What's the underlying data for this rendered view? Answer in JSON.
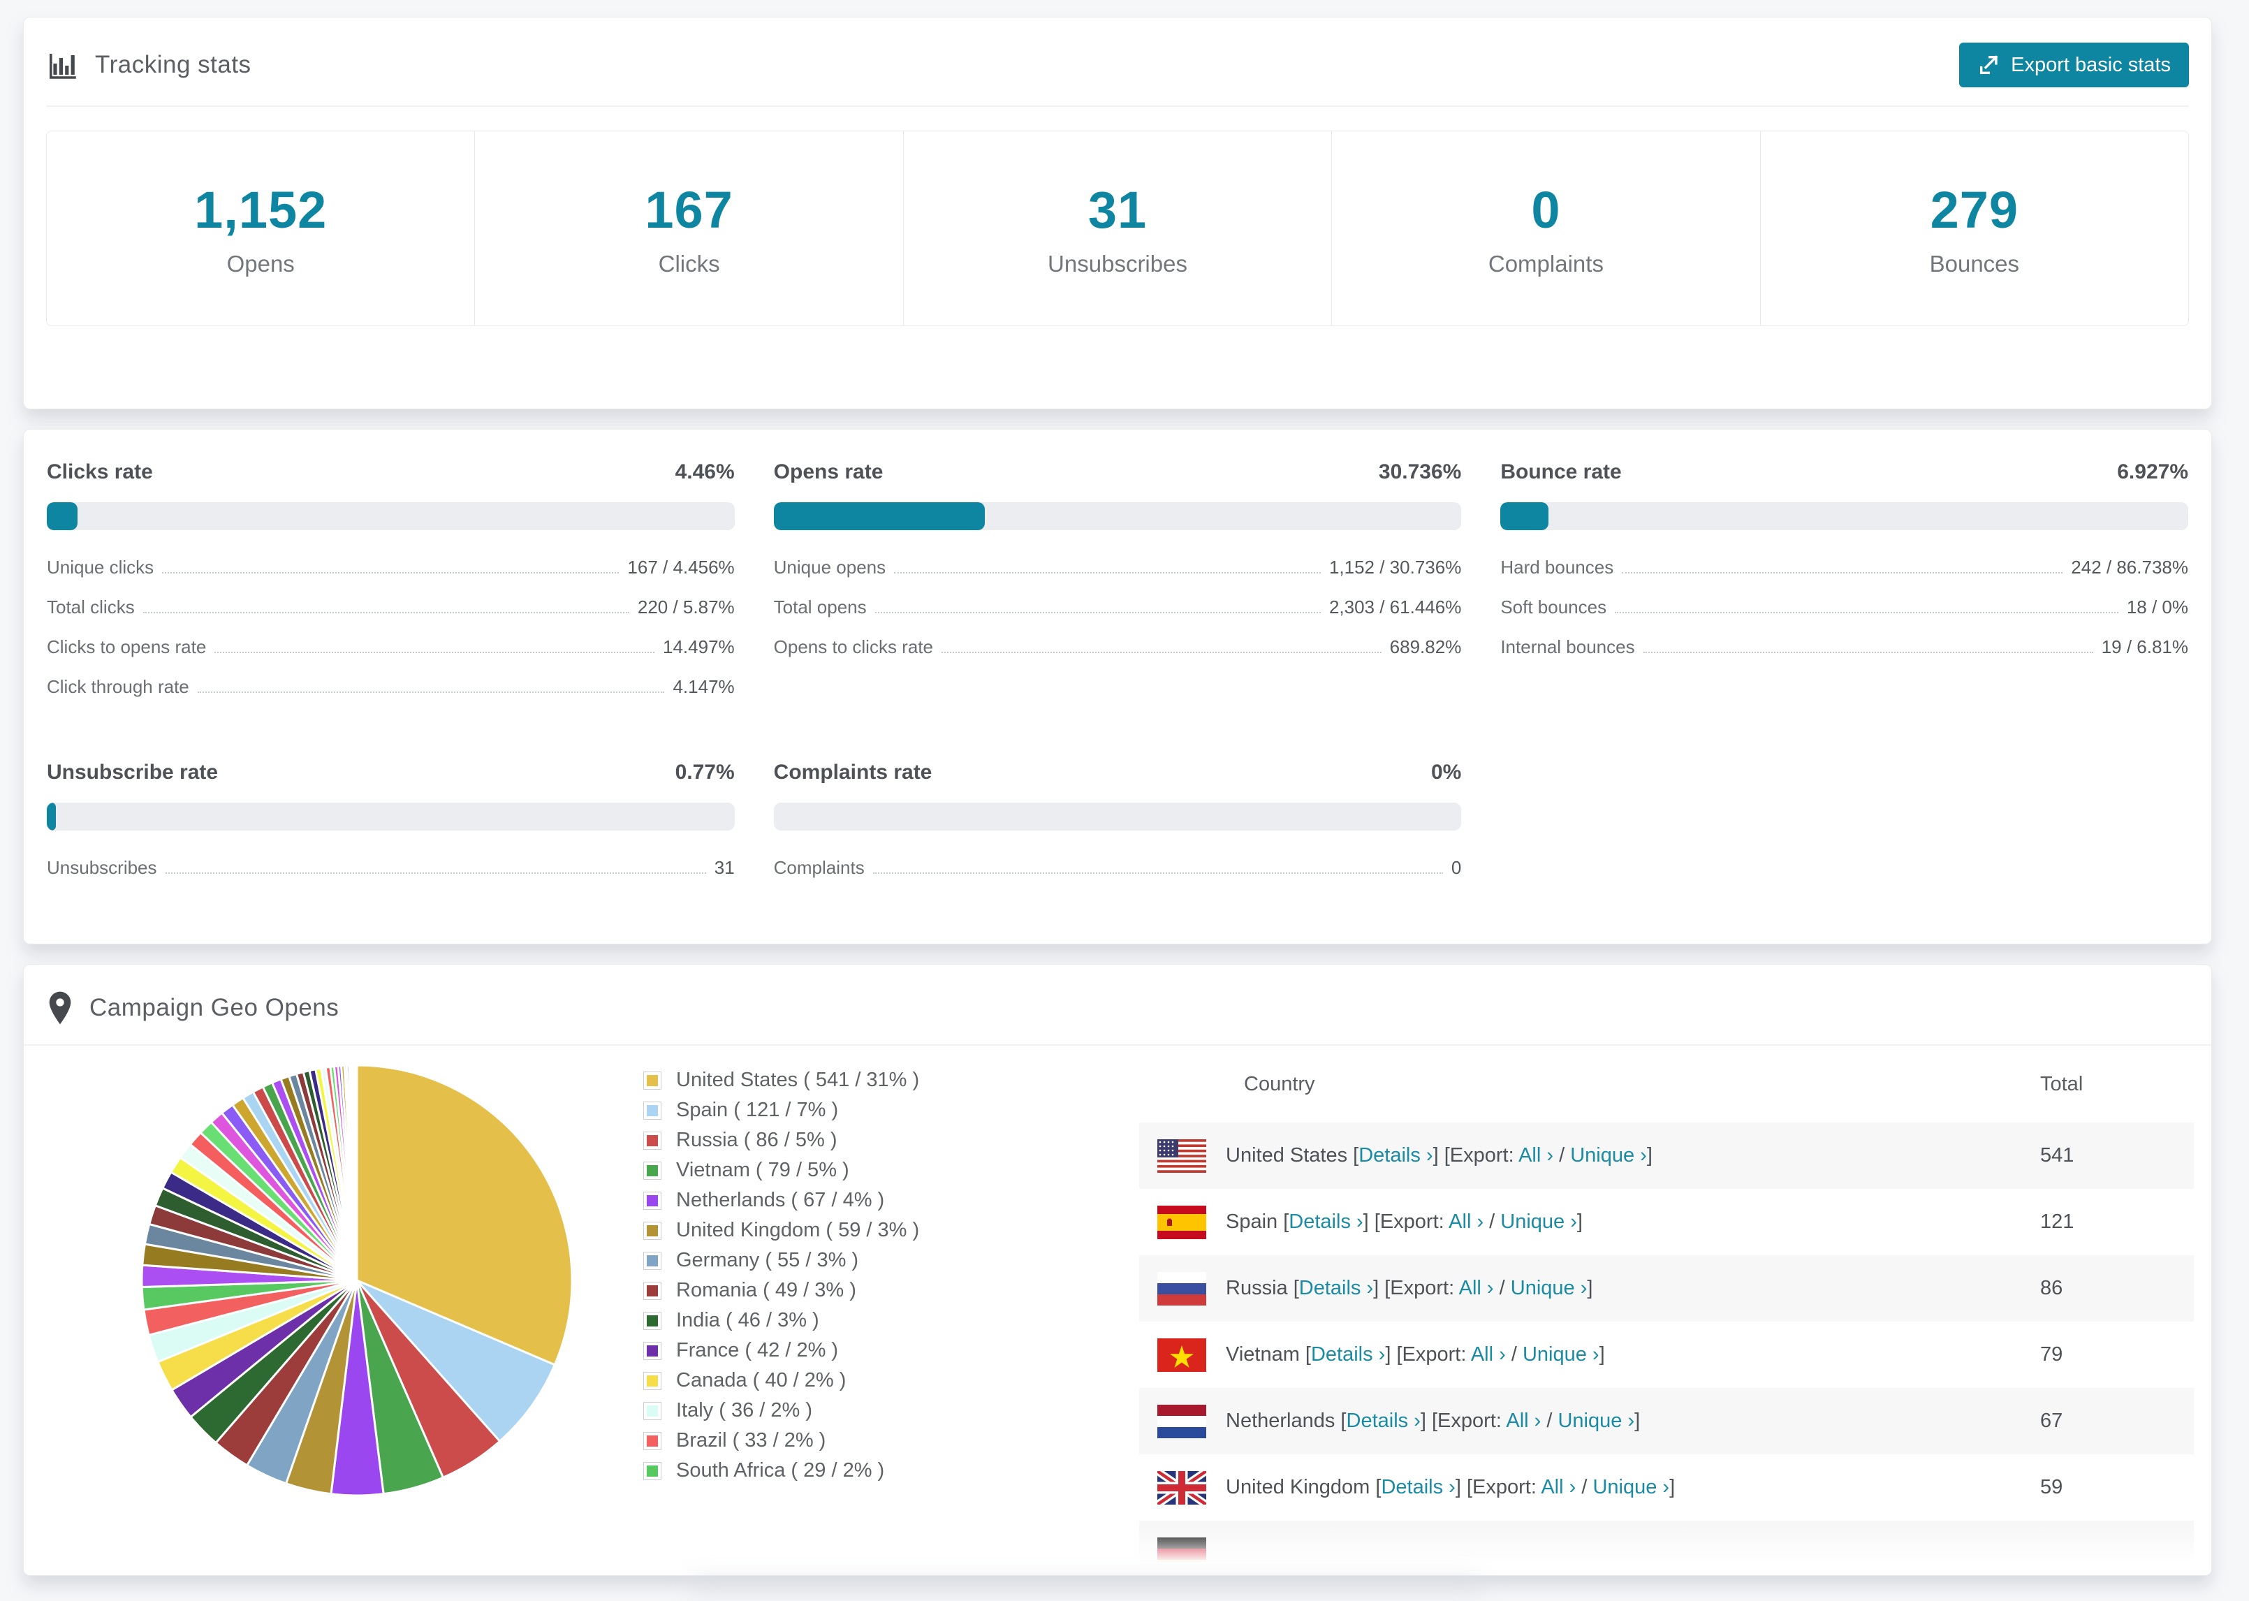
{
  "page": {
    "background": "#f6f7f9",
    "accent": "#0e86a1"
  },
  "tracking_card": {
    "title": "Tracking stats",
    "export_button": {
      "label": "Export basic stats"
    },
    "stats": [
      {
        "value": "1,152",
        "label": "Opens"
      },
      {
        "value": "167",
        "label": "Clicks"
      },
      {
        "value": "31",
        "label": "Unsubscribes"
      },
      {
        "value": "0",
        "label": "Complaints"
      },
      {
        "value": "279",
        "label": "Bounces"
      }
    ]
  },
  "rates_card": {
    "sections": [
      {
        "title": "Clicks rate",
        "value": "4.46%",
        "percent": 4.46,
        "rows": [
          {
            "label": "Unique clicks",
            "value": "167 / 4.456%"
          },
          {
            "label": "Total clicks",
            "value": "220 / 5.87%"
          },
          {
            "label": "Clicks to opens rate",
            "value": "14.497%"
          },
          {
            "label": "Click through rate",
            "value": "4.147%"
          }
        ]
      },
      {
        "title": "Opens rate",
        "value": "30.736%",
        "percent": 30.736,
        "rows": [
          {
            "label": "Unique opens",
            "value": "1,152 / 30.736%"
          },
          {
            "label": "Total opens",
            "value": "2,303 / 61.446%"
          },
          {
            "label": "Opens to clicks rate",
            "value": "689.82%"
          }
        ]
      },
      {
        "title": "Bounce rate",
        "value": "6.927%",
        "percent": 6.927,
        "rows": [
          {
            "label": "Hard bounces",
            "value": "242 / 86.738%"
          },
          {
            "label": "Soft bounces",
            "value": "18 / 0%"
          },
          {
            "label": "Internal bounces",
            "value": "19 / 6.81%"
          }
        ]
      },
      {
        "title": "Unsubscribe rate",
        "value": "0.77%",
        "percent": 0.77,
        "rows": [
          {
            "label": "Unsubscribes",
            "value": "31"
          }
        ]
      },
      {
        "title": "Complaints rate",
        "value": "0%",
        "percent": 0,
        "rows": [
          {
            "label": "Complaints",
            "value": "0"
          }
        ]
      }
    ]
  },
  "geo_card": {
    "title": "Campaign Geo Opens",
    "table": {
      "headers": [
        "Country",
        "Total"
      ],
      "details_label": "Details ›",
      "export_label": "Export:",
      "all_label": "All ›",
      "unique_label": "Unique ›",
      "rows": [
        {
          "country": "United States",
          "flag": "us",
          "total": "541"
        },
        {
          "country": "Spain",
          "flag": "es",
          "total": "121"
        },
        {
          "country": "Russia",
          "flag": "ru",
          "total": "86"
        },
        {
          "country": "Vietnam",
          "flag": "vn",
          "total": "79"
        },
        {
          "country": "Netherlands",
          "flag": "nl",
          "total": "67"
        },
        {
          "country": "United Kingdom",
          "flag": "gb",
          "total": "59"
        },
        {
          "country": "",
          "flag": "de",
          "total": "",
          "partial": true
        }
      ]
    }
  },
  "chart_data": {
    "type": "pie",
    "title": "Campaign Geo Opens",
    "legend_position": "right",
    "start_angle_deg": -90,
    "direction": "clockwise",
    "countries": [
      {
        "name": "United States",
        "opens": 541,
        "pct": "31%",
        "color": "#e4c04a"
      },
      {
        "name": "Spain",
        "opens": 121,
        "pct": "7%",
        "color": "#abd4f2"
      },
      {
        "name": "Russia",
        "opens": 86,
        "pct": "5%",
        "color": "#cc4b4b"
      },
      {
        "name": "Vietnam",
        "opens": 79,
        "pct": "5%",
        "color": "#4aa64e"
      },
      {
        "name": "Netherlands",
        "opens": 67,
        "pct": "4%",
        "color": "#9b47ef"
      },
      {
        "name": "United Kingdom",
        "opens": 59,
        "pct": "3%",
        "color": "#b29336"
      },
      {
        "name": "Germany",
        "opens": 55,
        "pct": "3%",
        "color": "#7fa4c4"
      },
      {
        "name": "Romania",
        "opens": 49,
        "pct": "3%",
        "color": "#9d3d3b"
      },
      {
        "name": "India",
        "opens": 46,
        "pct": "3%",
        "color": "#2d6a32"
      },
      {
        "name": "France",
        "opens": 42,
        "pct": "2%",
        "color": "#6d30a9"
      },
      {
        "name": "Canada",
        "opens": 40,
        "pct": "2%",
        "color": "#f6de4b"
      },
      {
        "name": "Italy",
        "opens": 36,
        "pct": "2%",
        "color": "#dafcf4"
      },
      {
        "name": "Brazil",
        "opens": 33,
        "pct": "2%",
        "color": "#f26060"
      },
      {
        "name": "South Africa",
        "opens": 29,
        "pct": "2%",
        "color": "#57c960"
      }
    ],
    "unlabeled_tail": {
      "note": "many small unlabeled country slices tapering toward 12 o'clock",
      "values": [
        28,
        27,
        26,
        25,
        24,
        23,
        22,
        21,
        20,
        19,
        18,
        17,
        16,
        15,
        14,
        13,
        12,
        11,
        10,
        9,
        8,
        8,
        7,
        6,
        6,
        5,
        5,
        4,
        4,
        3,
        3,
        2,
        2,
        2,
        1,
        1,
        1,
        1
      ],
      "colors": [
        "#ab4ef2",
        "#977b20",
        "#6b879f",
        "#8c3a3a",
        "#2e5e30",
        "#3b2b86",
        "#f4f443",
        "#e8fdf6",
        "#f45e5e",
        "#69df73",
        "#de56de",
        "#8a5cf5",
        "#cda62f",
        "#a9d5f3",
        "#cb4b4b",
        "#49a54d"
      ]
    }
  }
}
